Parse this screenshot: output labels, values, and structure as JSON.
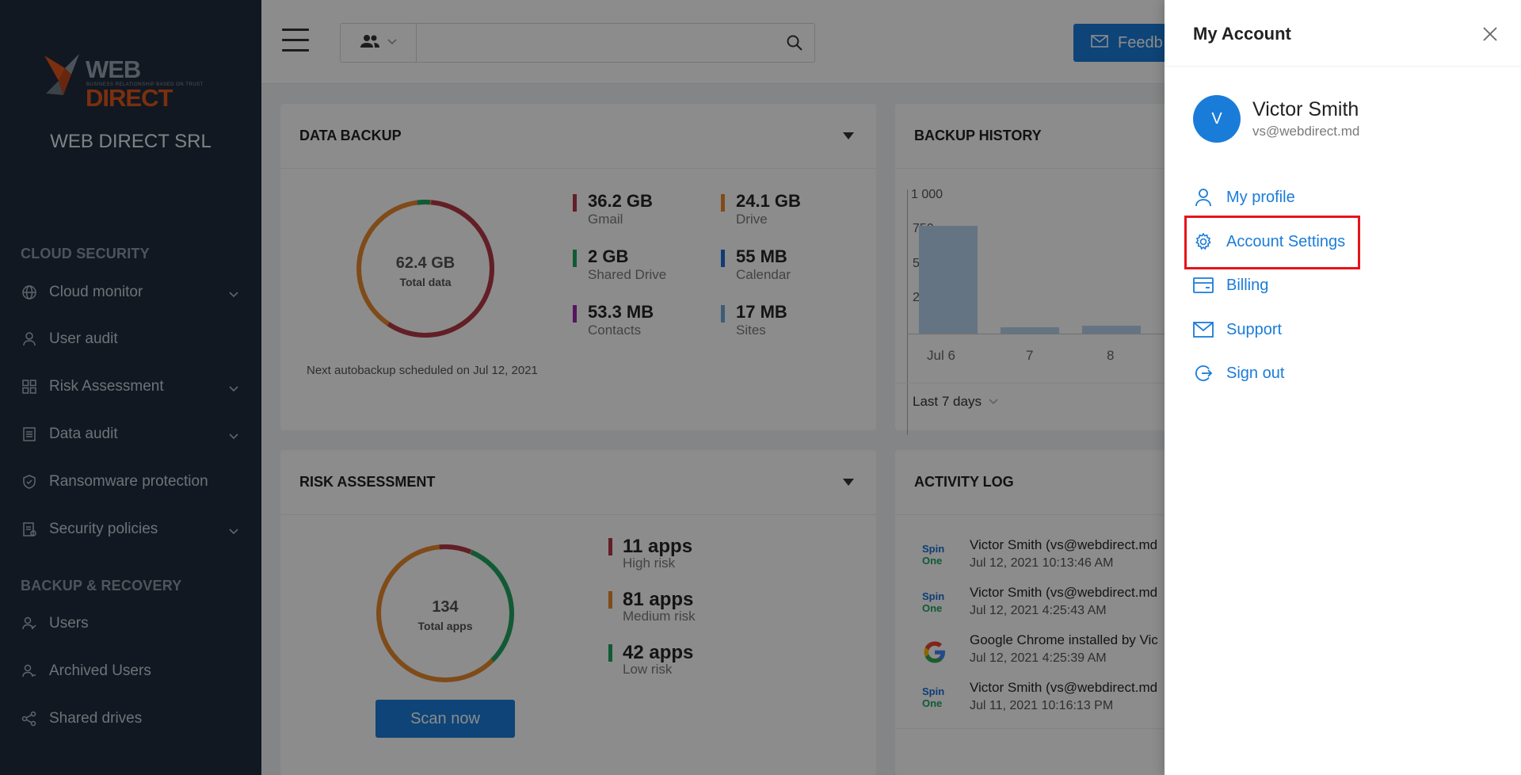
{
  "sidebar": {
    "brand_primary": "WEB",
    "brand_accent": "DIRECT",
    "brand_tagline": "BUSINESS RELATIONSHIP BASED ON TRUST",
    "org_name": "WEB DIRECT SRL",
    "sections": [
      {
        "title": "CLOUD SECURITY",
        "items": [
          {
            "label": "Cloud monitor",
            "icon": "globe-icon",
            "expandable": true
          },
          {
            "label": "User audit",
            "icon": "user-icon",
            "expandable": false
          },
          {
            "label": "Risk Assessment",
            "icon": "grid-icon",
            "expandable": true
          },
          {
            "label": "Data audit",
            "icon": "document-icon",
            "expandable": true
          },
          {
            "label": "Ransomware protection",
            "icon": "shield-icon",
            "expandable": false
          },
          {
            "label": "Security policies",
            "icon": "policy-icon",
            "expandable": true
          }
        ]
      },
      {
        "title": "BACKUP & RECOVERY",
        "items": [
          {
            "label": "Users",
            "icon": "users-icon",
            "expandable": false
          },
          {
            "label": "Archived Users",
            "icon": "archived-users-icon",
            "expandable": false
          },
          {
            "label": "Shared drives",
            "icon": "share-icon",
            "expandable": false
          }
        ]
      }
    ]
  },
  "topbar": {
    "search_placeholder": "",
    "feedback_label": "Feedb"
  },
  "data_backup": {
    "title": "DATA BACKUP",
    "total_value": "62.4 GB",
    "total_label": "Total data",
    "schedule_note": "Next autobackup scheduled on Jul 12, 2021",
    "stats": [
      {
        "value": "36.2 GB",
        "label": "Gmail",
        "color": "#b23a48"
      },
      {
        "value": "24.1 GB",
        "label": "Drive",
        "color": "#e8892e"
      },
      {
        "value": "2 GB",
        "label": "Shared Drive",
        "color": "#1fa463"
      },
      {
        "value": "55 MB",
        "label": "Calendar",
        "color": "#1a6fd6"
      },
      {
        "value": "53.3 MB",
        "label": "Contacts",
        "color": "#9b27b0"
      },
      {
        "value": "17 MB",
        "label": "Sites",
        "color": "#6fa8dc"
      }
    ]
  },
  "backup_history": {
    "title": "BACKUP HISTORY",
    "range_label": "Last 7 days",
    "y_ticks": [
      "1 000",
      "750",
      "500",
      "250"
    ],
    "x_ticks": [
      "Jul 6",
      "7",
      "8"
    ]
  },
  "risk_assessment": {
    "title": "RISK ASSESSMENT",
    "total_value": "134",
    "total_label": "Total apps",
    "scan_label": "Scan now",
    "stats": [
      {
        "value": "11 apps",
        "label": "High risk",
        "color": "#b23a48"
      },
      {
        "value": "81 apps",
        "label": "Medium risk",
        "color": "#e8892e"
      },
      {
        "value": "42 apps",
        "label": "Low risk",
        "color": "#1fa463"
      }
    ]
  },
  "activity_log": {
    "title": "ACTIVITY LOG",
    "entries": [
      {
        "who": "Victor Smith (vs@webdirect.md",
        "when": "Jul 12, 2021 10:13:46 AM",
        "source": "spinone-logo"
      },
      {
        "who": "Victor Smith (vs@webdirect.md",
        "when": "Jul 12, 2021 4:25:43 AM",
        "source": "spinone-logo"
      },
      {
        "who": "Google Chrome installed by Vic",
        "when": "Jul 12, 2021 4:25:39 AM",
        "source": "google-logo"
      },
      {
        "who": "Victor Smith (vs@webdirect.md",
        "when": "Jul 11, 2021 10:16:13 PM",
        "source": "spinone-logo"
      }
    ],
    "logo_text_top": "Spin",
    "logo_text_bottom": "One"
  },
  "account_drawer": {
    "title": "My Account",
    "avatar_initial": "V",
    "user_name": "Victor Smith",
    "user_email": "vs@webdirect.md",
    "menu": [
      {
        "label": "My profile",
        "icon": "user-icon"
      },
      {
        "label": "Account Settings",
        "icon": "gear-icon",
        "highlighted": true
      },
      {
        "label": "Billing",
        "icon": "credit-card-icon"
      },
      {
        "label": "Support",
        "icon": "mail-icon"
      },
      {
        "label": "Sign out",
        "icon": "sign-out-icon"
      }
    ],
    "accent_color": "#1a7cd9",
    "highlight_color": "#e8141a"
  }
}
